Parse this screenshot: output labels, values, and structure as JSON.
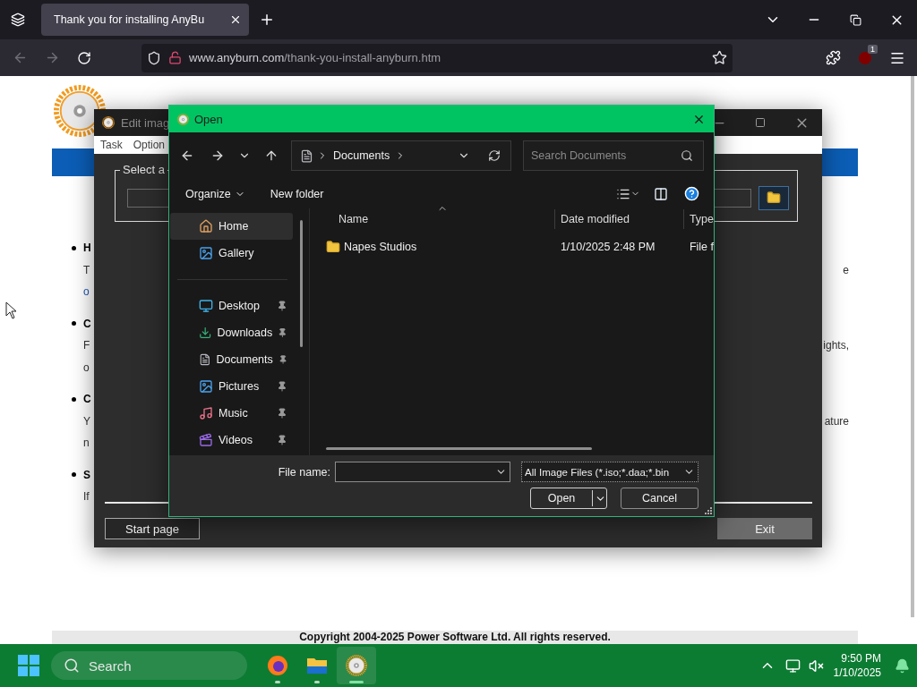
{
  "browser": {
    "tabs": [
      {
        "title": "Thank you for installing AnyBu",
        "selected": true
      }
    ],
    "address": {
      "domain": "www.anyburn.com",
      "path": "/thank-you-install-anyburn.htm"
    },
    "extension_badge": "1"
  },
  "page": {
    "sections": [
      {
        "heading": "H",
        "lines": [
          {
            "text": "T",
            "trailing": "e",
            "kind": "text"
          },
          {
            "text": "o",
            "kind": "link"
          }
        ]
      },
      {
        "heading": "C",
        "lines": [
          {
            "text": "F",
            "trailing": "ights,",
            "kind": "text"
          },
          {
            "text": "o",
            "kind": "text"
          }
        ]
      },
      {
        "heading": "C",
        "lines": [
          {
            "text": "Y",
            "trailing": "ature",
            "kind": "text"
          },
          {
            "text": "n",
            "kind": "text"
          }
        ]
      },
      {
        "heading": "S",
        "lines": [
          {
            "text": "If",
            "kind": "text"
          }
        ]
      }
    ],
    "copyright": "Copyright 2004-2025 Power Software Ltd. All rights reserved."
  },
  "edit_window": {
    "title": "Edit imag",
    "menu": [
      "Task",
      "Option"
    ],
    "group_label": "Select a",
    "buttons": [
      {
        "label": "Start page",
        "kind": "outline"
      },
      {
        "label": "Exit",
        "kind": "filled"
      }
    ]
  },
  "open_dialog": {
    "title": "Open",
    "breadcrumb": [
      "Documents"
    ],
    "search": {
      "placeholder": "Search Documents"
    },
    "commands": [
      {
        "label": "Organize",
        "kind": "menu"
      },
      {
        "label": "New folder",
        "kind": "plain"
      }
    ],
    "sidebar": [
      [
        {
          "label": "Home",
          "kind": "home",
          "selected": true,
          "pinned": false
        },
        {
          "label": "Gallery",
          "kind": "gallery",
          "selected": false,
          "pinned": false
        }
      ],
      [
        {
          "label": "Desktop",
          "kind": "desktop",
          "selected": false,
          "pinned": true
        },
        {
          "label": "Downloads",
          "kind": "downloads",
          "selected": false,
          "pinned": true
        },
        {
          "label": "Documents",
          "kind": "documents",
          "selected": false,
          "pinned": true
        },
        {
          "label": "Pictures",
          "kind": "pictures",
          "selected": false,
          "pinned": true
        },
        {
          "label": "Music",
          "kind": "music",
          "selected": false,
          "pinned": true
        },
        {
          "label": "Videos",
          "kind": "videos",
          "selected": false,
          "pinned": true
        }
      ]
    ],
    "columns": [
      "Name",
      "Date modified",
      "Type"
    ],
    "files": [
      {
        "name": "Napes Studios",
        "date": "1/10/2025 2:48 PM",
        "type": "File f",
        "selected": false
      }
    ],
    "file_name_label": "File name:",
    "filter": "All Image Files (*.iso;*.daa;*.bin",
    "buttons": [
      "Open",
      "Cancel"
    ]
  },
  "taskbar": {
    "search": "Search",
    "apps": [
      {
        "kind": "firefox",
        "selected": false
      },
      {
        "kind": "explorer",
        "selected": false
      },
      {
        "kind": "anyburn",
        "selected": true
      }
    ],
    "time": "9:50 PM",
    "date": "1/10/2025"
  }
}
